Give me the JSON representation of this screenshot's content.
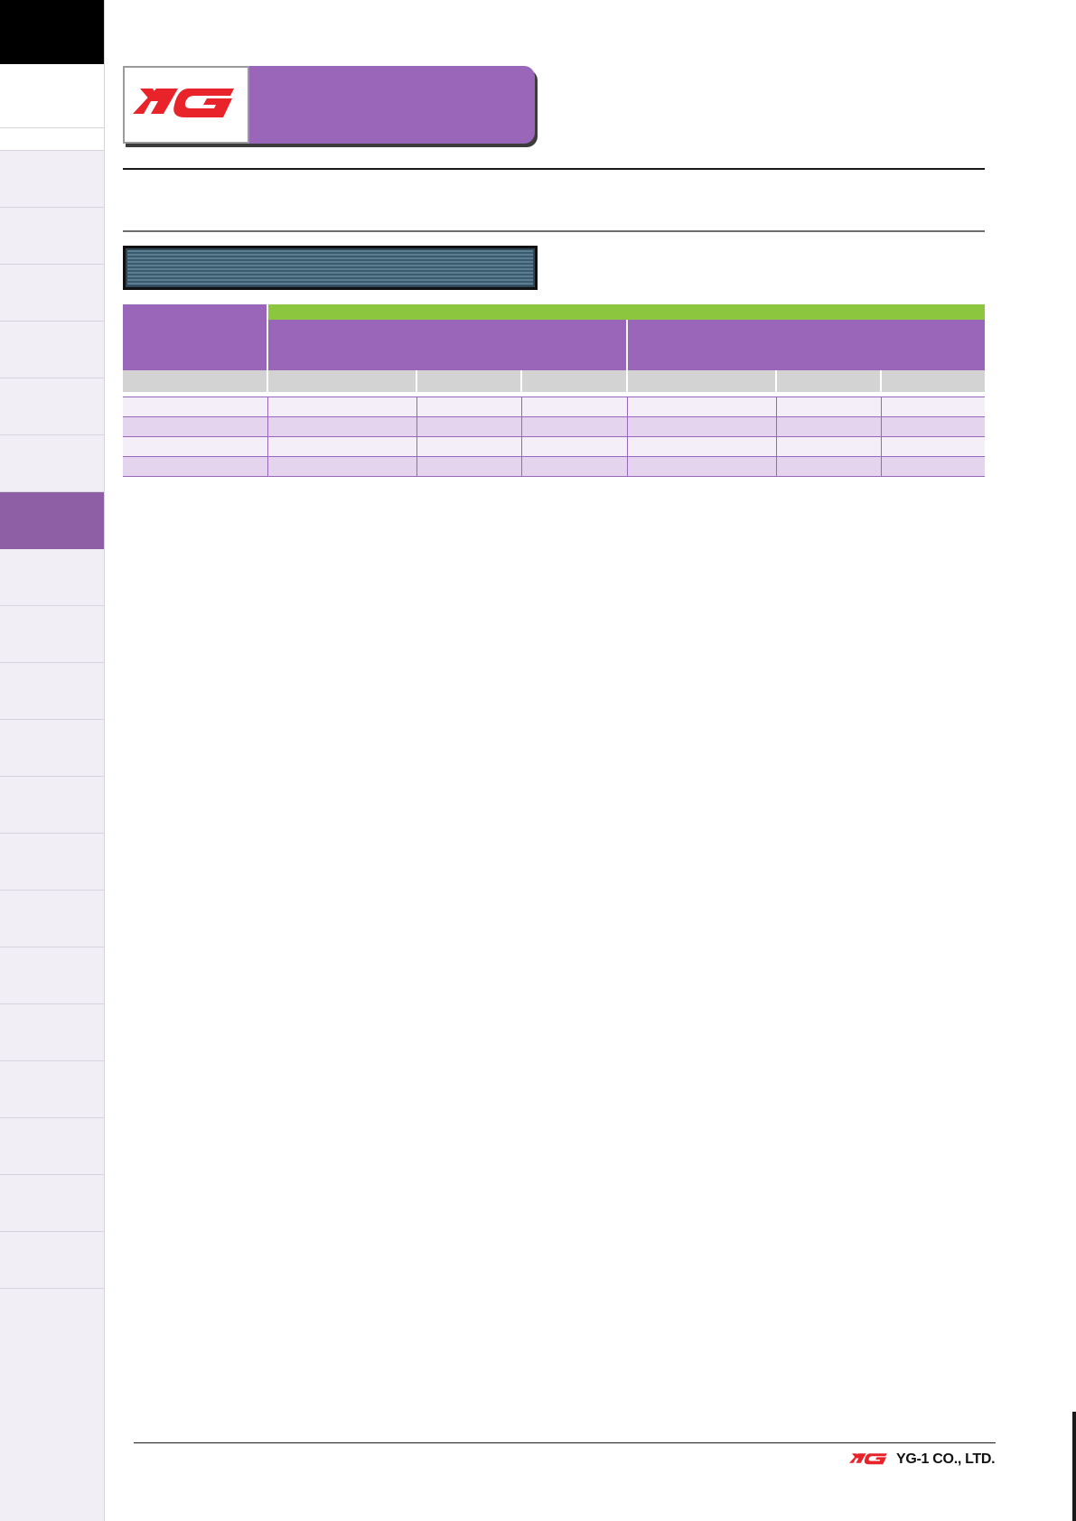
{
  "brand": {
    "logo_mark": "YG",
    "company_name": "YG-1 CO., LTD.",
    "logo_color": "#e8232a",
    "accent_color": "#9a66ba",
    "highlight_color": "#8cc63f"
  },
  "sidebar": {
    "active_tab_index": 6,
    "tab_count": 17
  },
  "table": {
    "rows": 4,
    "columns": 7
  }
}
